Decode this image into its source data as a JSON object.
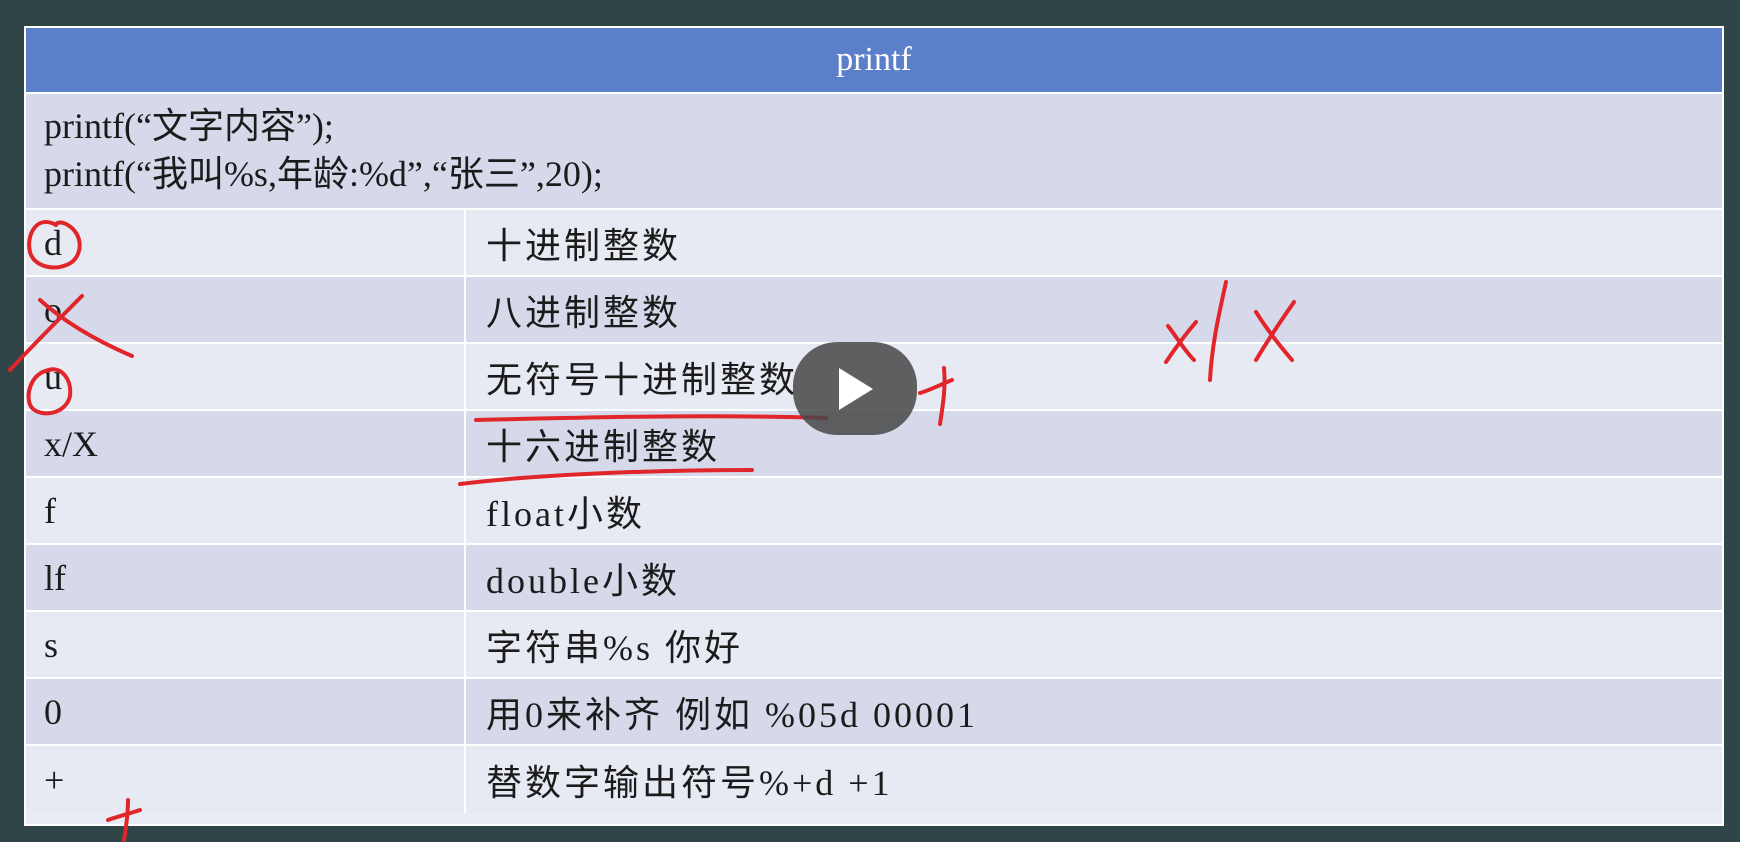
{
  "table": {
    "title": "printf",
    "intro_lines": [
      "printf(“文字内容”);",
      "printf(“我叫%s,年龄:%d”,“张三”,20);"
    ],
    "rows": [
      {
        "spec": "d",
        "desc": "十进制整数"
      },
      {
        "spec": "o",
        "desc": "八进制整数"
      },
      {
        "spec": "u",
        "desc": "无符号十进制整数"
      },
      {
        "spec": "x/X",
        "desc": "十六进制整数"
      },
      {
        "spec": "f",
        "desc": "float小数"
      },
      {
        "spec": "lf",
        "desc": "double小数"
      },
      {
        "spec": "s",
        "desc": "字符串%s 你好"
      },
      {
        "spec": "0",
        "desc": "用0来补齐 例如 %05d   00001"
      },
      {
        "spec": "+",
        "desc": "替数字输出符号%+d +1"
      }
    ]
  },
  "annotations": {
    "handwritten_note": "x/X",
    "pen_color": "#e0262a"
  },
  "player": {
    "play_icon": "play-icon"
  }
}
